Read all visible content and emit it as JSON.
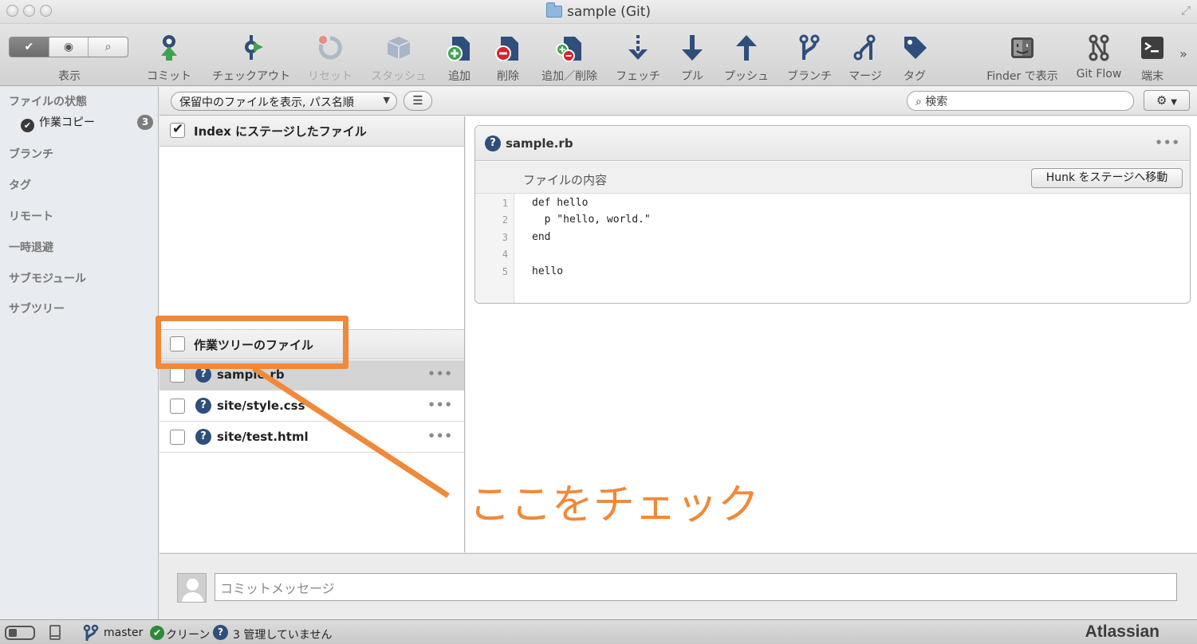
{
  "window": {
    "title": "sample (Git)"
  },
  "toolbar": {
    "view_label": "表示",
    "items": [
      {
        "label": "コミット",
        "icon": "commit-icon",
        "enabled": true
      },
      {
        "label": "チェックアウト",
        "icon": "checkout-icon",
        "enabled": true
      },
      {
        "label": "リセット",
        "icon": "reset-icon",
        "enabled": false
      },
      {
        "label": "スタッシュ",
        "icon": "stash-icon",
        "enabled": false
      },
      {
        "label": "追加",
        "icon": "add-icon",
        "enabled": true
      },
      {
        "label": "削除",
        "icon": "remove-icon",
        "enabled": true
      },
      {
        "label": "追加／削除",
        "icon": "add-remove-icon",
        "enabled": true
      },
      {
        "label": "フェッチ",
        "icon": "fetch-icon",
        "enabled": true
      },
      {
        "label": "プル",
        "icon": "pull-icon",
        "enabled": true
      },
      {
        "label": "プッシュ",
        "icon": "push-icon",
        "enabled": true
      },
      {
        "label": "ブランチ",
        "icon": "branch-icon",
        "enabled": true
      },
      {
        "label": "マージ",
        "icon": "merge-icon",
        "enabled": true
      },
      {
        "label": "タグ",
        "icon": "tag-icon",
        "enabled": true
      },
      {
        "label": "Finder で表示",
        "icon": "finder-icon",
        "enabled": true
      },
      {
        "label": "Git Flow",
        "icon": "git-flow-icon",
        "enabled": true
      },
      {
        "label": "端末",
        "icon": "terminal-icon",
        "enabled": true
      }
    ]
  },
  "sidebar": {
    "file_status": "ファイルの状態",
    "working_copy": "作業コピー",
    "working_copy_count": "3",
    "sections": [
      "ブランチ",
      "タグ",
      "リモート",
      "一時退避",
      "サブモジュール",
      "サブツリー"
    ]
  },
  "filter": {
    "selected": "保留中のファイルを表示, パス名順",
    "search_placeholder": "検索"
  },
  "staged": {
    "header": "Index にステージしたファイル",
    "checked": true
  },
  "unstaged": {
    "header": "作業ツリーのファイル",
    "files": [
      "sample.rb",
      "site/style.css",
      "site/test.html"
    ],
    "selected_index": 0
  },
  "diff": {
    "file": "sample.rb",
    "hunk_label": "ファイルの内容",
    "hunk_button": "Hunk をステージへ移動",
    "lines": [
      {
        "num": "1",
        "text": "def hello"
      },
      {
        "num": "2",
        "text": "  p \"hello, world.\""
      },
      {
        "num": "3",
        "text": "end"
      },
      {
        "num": "4",
        "text": ""
      },
      {
        "num": "5",
        "text": "hello"
      }
    ]
  },
  "commit": {
    "placeholder": "コミットメッセージ"
  },
  "status": {
    "branch": "master",
    "clean": "クリーン",
    "untracked": "3 管理していません",
    "brand": "Atlassian"
  },
  "annotation": {
    "text": "ここをチェック",
    "color": "#f0893a"
  },
  "colors": {
    "accent_orange": "#f0893a",
    "icon_navy": "#2f4e7a",
    "green": "#2d8a3a",
    "red": "#d8232a"
  }
}
